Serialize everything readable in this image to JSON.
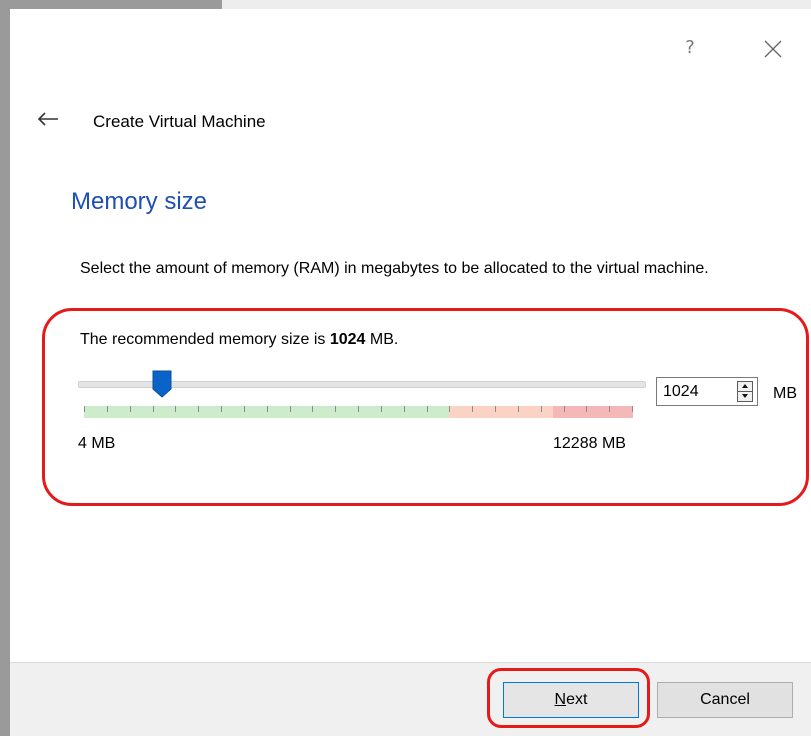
{
  "window": {
    "help_label": "?",
    "close_icon": "close-icon",
    "back_icon": "back-arrow-icon"
  },
  "wizard": {
    "title": "Create Virtual Machine",
    "heading": "Memory size",
    "description": "Select the amount of memory (RAM) in megabytes to be allocated to the virtual machine."
  },
  "memory": {
    "recommended_prefix": "The recommended memory size is ",
    "recommended_value": "1024",
    "recommended_suffix": " MB.",
    "min_label": "4 MB",
    "max_label": "12288 MB",
    "current_value": "1024",
    "unit": "MB",
    "min_mb": 4,
    "max_mb": 12288,
    "value_mb": 1024,
    "safe_limit_fraction": 0.665,
    "warn_limit_fraction": 0.855
  },
  "buttons": {
    "next_mnemonic": "N",
    "next_rest": "ext",
    "cancel": "Cancel"
  },
  "colors": {
    "heading": "#1e4fb5",
    "annotation": "#e51a1a",
    "scale_green": "#cdeccb",
    "scale_orange": "#fbd3c4",
    "scale_red": "#f4b8b8",
    "slider_thumb": "#0a64c8",
    "default_button_border": "#0078d7"
  }
}
